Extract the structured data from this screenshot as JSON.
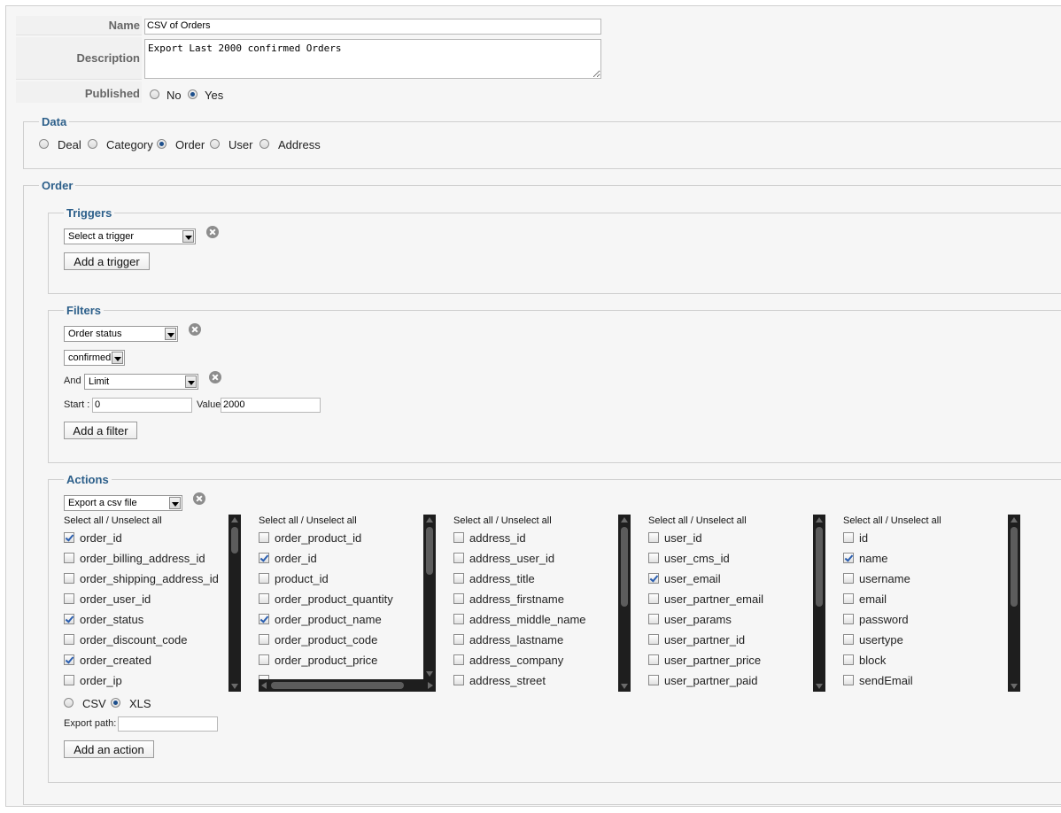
{
  "form": {
    "name_label": "Name",
    "name_value": "CSV of Orders",
    "description_label": "Description",
    "description_value": "Export Last 2000 confirmed Orders",
    "published_label": "Published",
    "published_options": [
      "No",
      "Yes"
    ],
    "published_selected": "Yes"
  },
  "data_section": {
    "legend": "Data",
    "options": [
      "Deal",
      "Category",
      "Order",
      "User",
      "Address"
    ],
    "selected": "Order"
  },
  "order_section": {
    "legend": "Order"
  },
  "triggers": {
    "legend": "Triggers",
    "select_value": "Select a trigger",
    "add_button": "Add a trigger"
  },
  "filters": {
    "legend": "Filters",
    "filter_select": "Order status",
    "status_select": "confirmed",
    "and_label": "And",
    "limit_select": "Limit",
    "start_label": "Start :",
    "start_value": "0",
    "value_label": "Value",
    "value_value": "2000",
    "add_button": "Add a filter"
  },
  "actions": {
    "legend": "Actions",
    "action_select": "Export a csv file",
    "select_all_label": "Select all / Unselect all",
    "columns": [
      {
        "items": [
          {
            "label": "order_id",
            "checked": true
          },
          {
            "label": "order_billing_address_id",
            "checked": false
          },
          {
            "label": "order_shipping_address_id",
            "checked": false
          },
          {
            "label": "order_user_id",
            "checked": false
          },
          {
            "label": "order_status",
            "checked": true
          },
          {
            "label": "order_discount_code",
            "checked": false
          },
          {
            "label": "order_created",
            "checked": true
          },
          {
            "label": "order_ip",
            "checked": false
          }
        ]
      },
      {
        "items": [
          {
            "label": "order_product_id",
            "checked": false
          },
          {
            "label": "order_id",
            "checked": true
          },
          {
            "label": "product_id",
            "checked": false
          },
          {
            "label": "order_product_quantity",
            "checked": false
          },
          {
            "label": "order_product_name",
            "checked": true
          },
          {
            "label": "order_product_code",
            "checked": false
          },
          {
            "label": "order_product_price",
            "checked": false
          }
        ]
      },
      {
        "items": [
          {
            "label": "address_id",
            "checked": false
          },
          {
            "label": "address_user_id",
            "checked": false
          },
          {
            "label": "address_title",
            "checked": false
          },
          {
            "label": "address_firstname",
            "checked": false
          },
          {
            "label": "address_middle_name",
            "checked": false
          },
          {
            "label": "address_lastname",
            "checked": false
          },
          {
            "label": "address_company",
            "checked": false
          },
          {
            "label": "address_street",
            "checked": false
          }
        ]
      },
      {
        "items": [
          {
            "label": "user_id",
            "checked": false
          },
          {
            "label": "user_cms_id",
            "checked": false
          },
          {
            "label": "user_email",
            "checked": true
          },
          {
            "label": "user_partner_email",
            "checked": false
          },
          {
            "label": "user_params",
            "checked": false
          },
          {
            "label": "user_partner_id",
            "checked": false
          },
          {
            "label": "user_partner_price",
            "checked": false
          },
          {
            "label": "user_partner_paid",
            "checked": false
          }
        ]
      },
      {
        "items": [
          {
            "label": "id",
            "checked": false
          },
          {
            "label": "name",
            "checked": true
          },
          {
            "label": "username",
            "checked": false
          },
          {
            "label": "email",
            "checked": false
          },
          {
            "label": "password",
            "checked": false
          },
          {
            "label": "usertype",
            "checked": false
          },
          {
            "label": "block",
            "checked": false
          },
          {
            "label": "sendEmail",
            "checked": false
          }
        ]
      }
    ],
    "format_options": [
      "CSV",
      "XLS"
    ],
    "format_selected": "XLS",
    "export_path_label": "Export path:",
    "export_path_value": "",
    "add_button": "Add an action"
  }
}
